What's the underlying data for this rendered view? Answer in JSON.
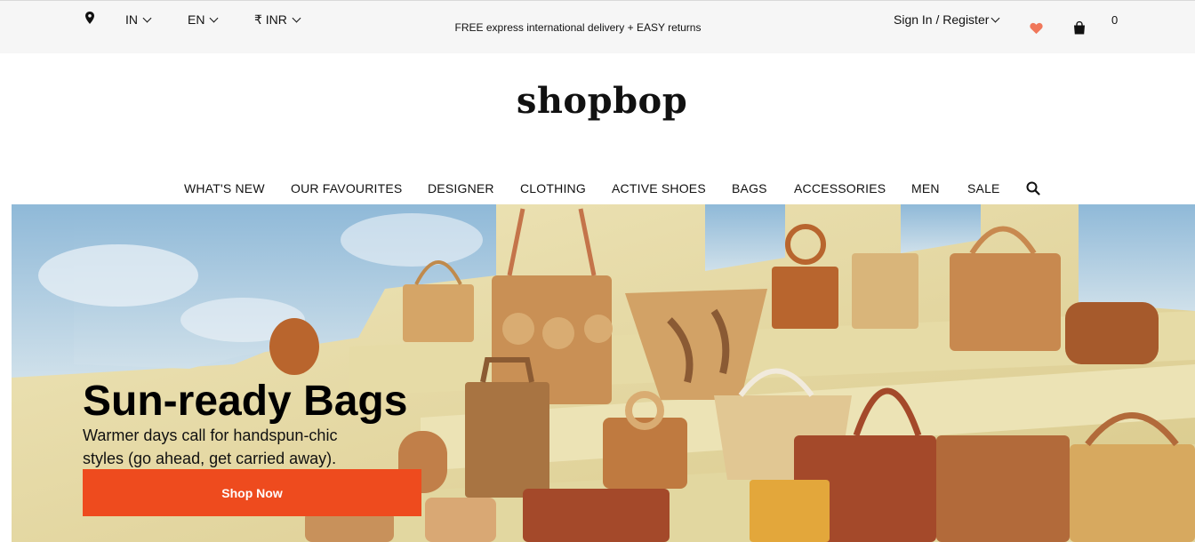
{
  "topbar": {
    "country": "IN",
    "language": "EN",
    "currency": "₹ INR",
    "promo": "FREE express international delivery + EASY returns",
    "signin": "Sign In / Register",
    "cart_count": "0"
  },
  "logo": "shopbop",
  "nav": {
    "items": [
      "WHAT'S NEW",
      "OUR FAVOURITES",
      "DESIGNER",
      "CLOTHING",
      "ACTIVE SHOES",
      "BAGS",
      "ACCESSORIES",
      "MEN",
      "SALE"
    ]
  },
  "hero": {
    "title": "Sun-ready Bags",
    "subtitle": "Warmer days call for handspun-chic styles (go ahead, get carried away).",
    "cta": "Shop Now"
  },
  "colors": {
    "accent": "#ee4b1e",
    "heart": "#f0775a",
    "topbar_bg": "#f6f6f6"
  },
  "icons": [
    "location-pin-icon",
    "chevron-down-icon",
    "heart-icon",
    "shopping-bag-icon",
    "search-icon"
  ]
}
